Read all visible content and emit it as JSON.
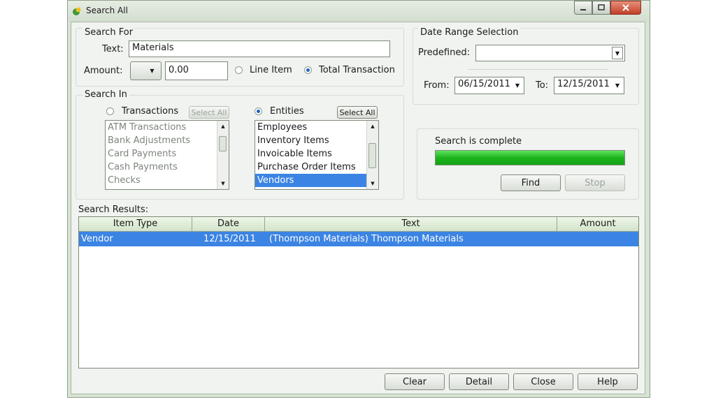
{
  "window": {
    "title": "Search All"
  },
  "search_for": {
    "group_label": "Search For",
    "text_label": "Text:",
    "text_value": "Materials",
    "amount_label": "Amount:",
    "amount_operator": "",
    "amount_value": "0.00",
    "radio_line_item": "Line Item",
    "radio_total_transaction": "Total Transaction",
    "selected_radio": "Total Transaction"
  },
  "date_range": {
    "group_label": "Date Range Selection",
    "predefined_label": "Predefined:",
    "predefined_value": "",
    "from_label": "From:",
    "from_value": "06/15/2011",
    "to_label": "To:",
    "to_value": "12/15/2011"
  },
  "search_in": {
    "group_label": "Search In",
    "transactions_label": "Transactions",
    "transactions_select_all": "Select All",
    "transactions_items": [
      "ATM Transactions",
      "Bank Adjustments",
      "Card Payments",
      "Cash Payments",
      "Checks"
    ],
    "entities_label": "Entities",
    "entities_select_all": "Select All",
    "entities_items": [
      "Employees",
      "Inventory Items",
      "Invoicable Items",
      "Purchase Order Items",
      "Vendors"
    ],
    "entities_selected": "Vendors",
    "selected_radio": "Entities"
  },
  "status": {
    "message": "Search is complete",
    "progress_fraction": 1.0,
    "find_label": "Find",
    "stop_label": "Stop"
  },
  "results": {
    "label": "Search Results:",
    "columns": [
      "Item Type",
      "Date",
      "Text",
      "Amount"
    ],
    "rows": [
      {
        "item_type": "Vendor",
        "date": "12/15/2011",
        "text": "(Thompson Materials) Thompson Materials",
        "amount": ""
      }
    ]
  },
  "footer": {
    "clear": "Clear",
    "detail": "Detail",
    "close": "Close",
    "help": "Help"
  },
  "colors": {
    "selection": "#3b84e3",
    "progress": "#1db41d",
    "window_bg": "#f0f3ef"
  },
  "icons": {
    "app": "app-logo-icon",
    "minimize": "minimize-icon",
    "maximize": "maximize-icon",
    "close": "close-icon"
  }
}
